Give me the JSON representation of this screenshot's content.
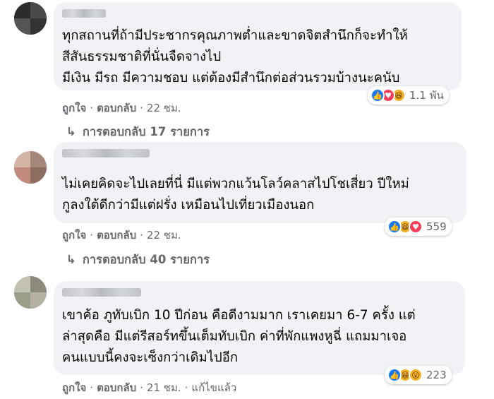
{
  "comments": [
    {
      "lines": [
        "ทุกสถานที่ถ้ามีประชากรคุณภาพต่ำและขาดจิตสำนึกก็จะทำให้",
        "สีสันธรรมชาติที่นั่นจืดจางไป",
        "มีเงิน มีรถ มีความชอบ แต่ต้องมีสำนึกต่อส่วนรวมบ้างนะคนับ"
      ],
      "reactions": {
        "icons": [
          "like-icon",
          "love-icon",
          "haha-icon"
        ],
        "count": "1.1 พัน"
      },
      "actions": {
        "like": "ถูกใจ",
        "reply": "ตอบกลับ",
        "time": "22 ชม.",
        "edited": ""
      },
      "replies_label": "การตอบกลับ 17 รายการ"
    },
    {
      "lines": [
        "ไม่เคยคิดจะไปเลยที่นี่ มีแต่พวกแว้นโลว์คลาสไปโชเสี่ยว ปีใหม่",
        "กูลงใต้ดีกว่ามีแต่ฝรั่ง เหมือนไปเที่ยวเมืองนอก"
      ],
      "reactions": {
        "icons": [
          "like-icon",
          "haha-icon",
          "love-icon"
        ],
        "count": "559"
      },
      "actions": {
        "like": "ถูกใจ",
        "reply": "ตอบกลับ",
        "time": "22 ชม.",
        "edited": ""
      },
      "replies_label": "การตอบกลับ 40 รายการ"
    },
    {
      "lines": [
        "เขาค้อ ภูทับเบิก 10 ปีก่อน คือดีงามมาก เราเคยมา 6-7 ครั้ง แต่",
        "ล่าสุดคือ มีแต่รีสอร์ทขึ้นเต็มทับเบิก ค่าที่พักแพงหูฉี่ แถมมาเจอ",
        "คนแบบนี้คงจะเซ็งกว่าเดิมไปอีก"
      ],
      "reactions": {
        "icons": [
          "like-icon",
          "haha-icon",
          "wow-icon"
        ],
        "count": "223"
      },
      "actions": {
        "like": "ถูกใจ",
        "reply": "ตอบกลับ",
        "time": "21 ชม.",
        "edited": "แก้ไขแล้ว"
      },
      "replies_label": ""
    }
  ],
  "separator": "·",
  "reply_arrow": "↳",
  "colors": {
    "bubble": "#f0f2f5",
    "like": "#1877f2",
    "love": "#f33e58",
    "haha": "#f7b125",
    "meta_text": "#65676b"
  }
}
